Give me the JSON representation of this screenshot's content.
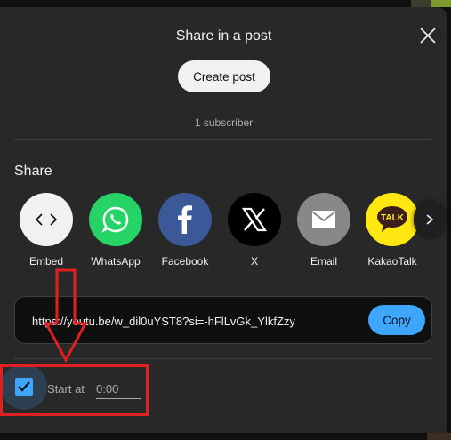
{
  "dialog": {
    "title": "Share in a post",
    "create_post_label": "Create post",
    "subscriber_count": "1 subscriber"
  },
  "share": {
    "heading": "Share",
    "targets": [
      {
        "label": "Embed",
        "icon": "embed-code-icon",
        "color": "#f1f1f1"
      },
      {
        "label": "WhatsApp",
        "icon": "whatsapp-icon",
        "color": "#25d366"
      },
      {
        "label": "Facebook",
        "icon": "facebook-icon",
        "color": "#3b5998"
      },
      {
        "label": "X",
        "icon": "x-logo-icon",
        "color": "#000000"
      },
      {
        "label": "Email",
        "icon": "email-icon",
        "color": "#888888"
      },
      {
        "label": "KakaoTalk",
        "icon": "kakaotalk-icon",
        "color": "#ffe812"
      }
    ],
    "next_icon": "chevron-right-icon"
  },
  "link": {
    "url": "https://youtu.be/w_dil0uYST8?si=-hFlLvGk_YlkfZzy",
    "copy_label": "Copy"
  },
  "start_at": {
    "checked": true,
    "label": "Start at",
    "time": "0:00"
  },
  "annotations": {
    "highlight_color": "#e02020",
    "arrow_icon": "down-arrow-annotation"
  }
}
